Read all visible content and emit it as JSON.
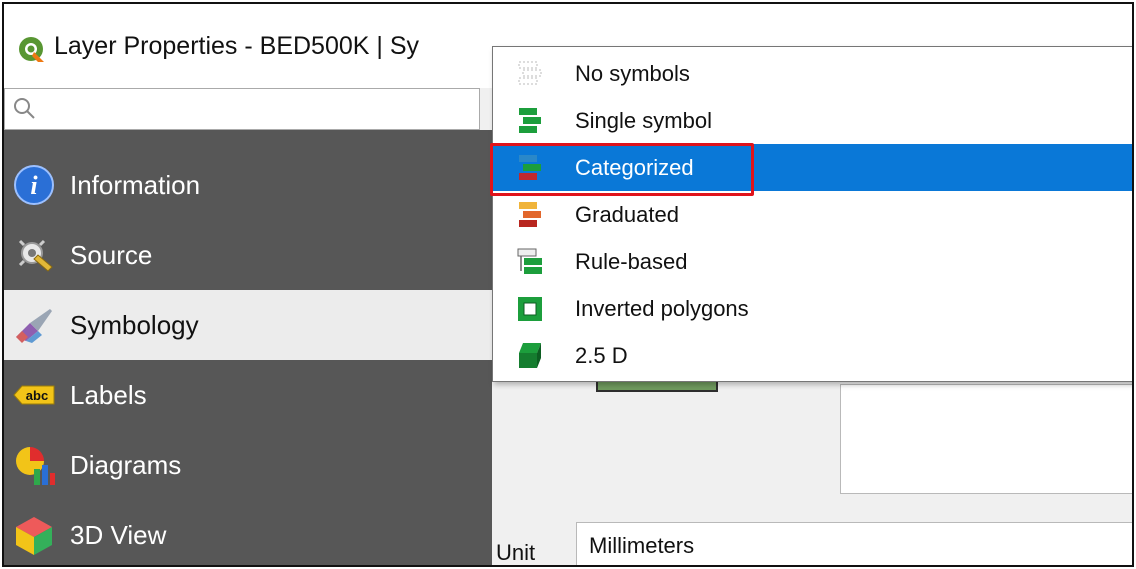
{
  "window": {
    "title": "Layer Properties - BED500K | Sy",
    "logo_icon": "qgis-logo-icon"
  },
  "search": {
    "placeholder": "",
    "value": "",
    "icon": "search-icon"
  },
  "sidebar": {
    "items": [
      {
        "label": "Information",
        "icon": "info-icon",
        "active": false
      },
      {
        "label": "Source",
        "icon": "source-gear-icon",
        "active": false
      },
      {
        "label": "Symbology",
        "icon": "paintbrush-icon",
        "active": true
      },
      {
        "label": "Labels",
        "icon": "abc-label-icon",
        "active": false
      },
      {
        "label": "Diagrams",
        "icon": "diagram-icon",
        "active": false
      },
      {
        "label": "3D View",
        "icon": "cube-icon",
        "active": false
      }
    ]
  },
  "renderer_menu": {
    "items": [
      {
        "label": "No symbols",
        "icon": "no-symbols-icon",
        "selected": false
      },
      {
        "label": "Single symbol",
        "icon": "single-symbol-icon",
        "selected": false
      },
      {
        "label": "Categorized",
        "icon": "categorized-icon",
        "selected": true
      },
      {
        "label": "Graduated",
        "icon": "graduated-icon",
        "selected": false
      },
      {
        "label": "Rule-based",
        "icon": "rule-based-icon",
        "selected": false
      },
      {
        "label": "Inverted polygons",
        "icon": "inverted-polygons-icon",
        "selected": false
      },
      {
        "label": "2.5 D",
        "icon": "two-point-five-d-icon",
        "selected": false
      }
    ]
  },
  "symbol_panel": {
    "unit_label": "Unit",
    "unit_value": "Millimeters"
  },
  "colors": {
    "sidebar_bg": "#575757",
    "active_item_bg": "#ececec",
    "selection_blue": "#0a78d7",
    "highlight_red": "#e0131b"
  }
}
